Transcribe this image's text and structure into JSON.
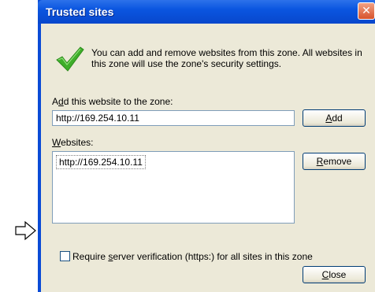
{
  "window": {
    "title": "Trusted sites",
    "close_glyph": "✕"
  },
  "info": {
    "icon": "green-checkmark-icon",
    "text": "You can add and remove websites from this zone. All websites in this zone will use the zone's security settings."
  },
  "add_section": {
    "label_pre": "A",
    "label_key": "d",
    "label_post": "d this website to the zone:",
    "input_value": "http://169.254.10.11",
    "add_button_key": "A",
    "add_button_rest": "dd"
  },
  "websites": {
    "label_key": "W",
    "label_post": "ebsites:",
    "items": [
      "http://169.254.10.11"
    ],
    "remove_button_key": "R",
    "remove_button_rest": "emove"
  },
  "verification": {
    "checked": false,
    "label_pre": "Require ",
    "label_key": "s",
    "label_post": "erver verification (https:) for all sites in this zone"
  },
  "footer": {
    "close_button_key": "C",
    "close_button_rest": "lose"
  },
  "colors": {
    "titlebar": "#0a55e0",
    "dialog_bg": "#ece9d8",
    "check_green": "#3fae2a"
  }
}
